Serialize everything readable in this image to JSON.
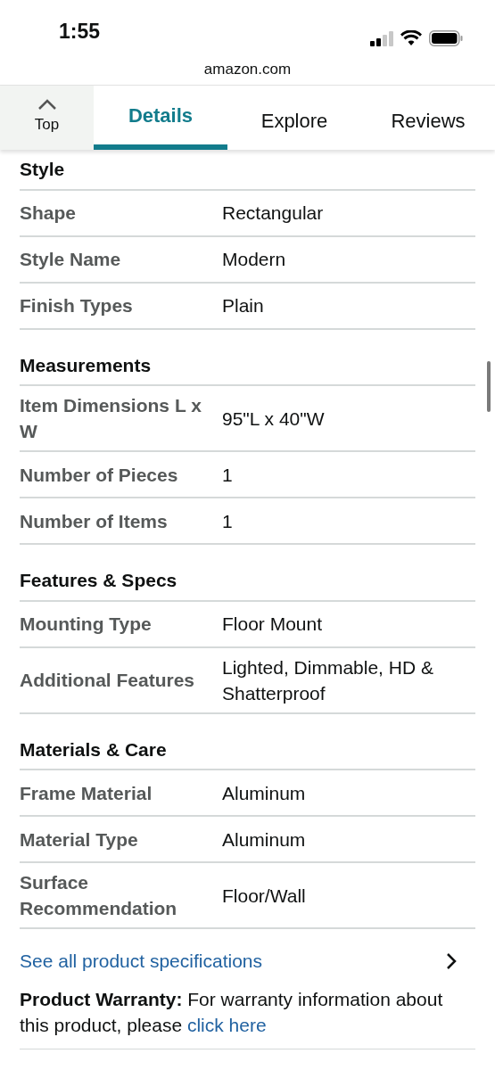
{
  "status_bar": {
    "time": "1:55"
  },
  "address_bar": {
    "url": "amazon.com"
  },
  "tabs": [
    {
      "label": "Top",
      "kind": "top",
      "selected": false
    },
    {
      "label": "Details",
      "kind": "tab",
      "selected": true
    },
    {
      "label": "Explore",
      "kind": "tab",
      "selected": false
    },
    {
      "label": "Reviews",
      "kind": "tab",
      "selected": false
    }
  ],
  "sections": [
    {
      "title": "Style",
      "rows": [
        {
          "label": "Shape",
          "value": "Rectangular"
        },
        {
          "label": "Style Name",
          "value": "Modern"
        },
        {
          "label": "Finish Types",
          "value": "Plain"
        }
      ]
    },
    {
      "title": "Measurements",
      "rows": [
        {
          "label": "Item Dimensions L x W",
          "value": "95\"L x 40\"W"
        },
        {
          "label": "Number of Pieces",
          "value": "1"
        },
        {
          "label": "Number of Items",
          "value": "1"
        }
      ]
    },
    {
      "title": "Features & Specs",
      "rows": [
        {
          "label": "Mounting Type",
          "value": "Floor Mount"
        },
        {
          "label": "Additional Features",
          "value": "Lighted, Dimmable, HD & Shatterproof"
        }
      ]
    },
    {
      "title": "Materials & Care",
      "rows": [
        {
          "label": "Frame Material",
          "value": "Aluminum"
        },
        {
          "label": "Material Type",
          "value": "Aluminum"
        },
        {
          "label": "Surface Recommendation",
          "value": "Floor/Wall"
        }
      ]
    }
  ],
  "see_all_link": "See all product specifications",
  "warranty": {
    "text": "**Product Warranty:** For warranty information about this product, please",
    "link": "click here"
  }
}
